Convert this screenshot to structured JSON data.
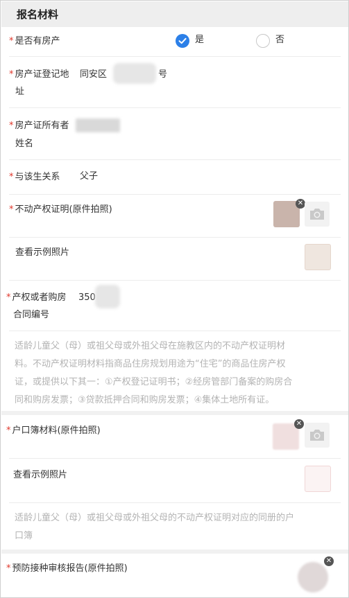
{
  "header": {
    "title": "报名材料"
  },
  "required_mark": "*",
  "has_property": {
    "label": "是否有房产",
    "yes": "是",
    "no": "否",
    "selected": "yes"
  },
  "cert_address": {
    "label_line1": "房产证登记地",
    "label_line2": "址",
    "value_prefix": "同安区",
    "value_suffix": "号"
  },
  "cert_owner": {
    "label_line1": "房产证所有者",
    "label_line2": "姓名"
  },
  "relation": {
    "label": "与该生关系",
    "value": "父子"
  },
  "property_proof": {
    "label": "不动产权证明(原件拍照)",
    "sample_label": "查看示例照片"
  },
  "contract_no": {
    "label_line1": "产权或者购房",
    "label_line2": "合同编号",
    "value_prefix": "350"
  },
  "property_note": {
    "lines": [
      "适龄儿童父（母）或祖父母或外祖父母在施教区内的不动产权证明材",
      "料。不动产权证明材料指商品住房规划用途为“住宅”的商品住房产权",
      "证，或提供以下其一：①产权登记证明书；②经房管部门备案的购房合",
      "同和购房发票；③贷款抵押合同和购房发票；④集体土地所有证。"
    ]
  },
  "household": {
    "label": "户口簿材料(原件拍照)",
    "sample_label": "查看示例照片",
    "note_lines": [
      "适龄儿童父（母）或祖父母或外祖父母的不动产权证明对应的同册的户",
      "口簿"
    ]
  },
  "vaccine": {
    "label": "预防接种审核报告(原件拍照)"
  },
  "icons": {
    "check": "check-icon",
    "camera": "camera-icon",
    "close": "close-icon"
  },
  "colors": {
    "accent": "#2c80e8",
    "required": "#e0362a",
    "note": "#b3b3b3"
  }
}
